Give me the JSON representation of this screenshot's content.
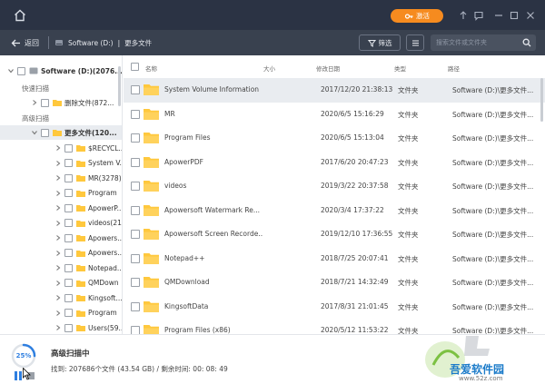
{
  "titlebar": {
    "activate_label": "激活"
  },
  "navbar": {
    "back_label": "返回",
    "breadcrumb": [
      "Software (D:)",
      "更多文件"
    ],
    "filter_label": "筛选",
    "search_placeholder": "搜索文件或文件夹"
  },
  "sidebar": {
    "root_label": "Software (D:)(2076...",
    "quick_scan_section": "快速扫描",
    "deleted_files_label": "删除文件(872...",
    "advanced_scan_section": "高级扫描",
    "more_files_label": "更多文件(120...",
    "tree_items": [
      "$RECYCL...",
      "System V...",
      "MR(3278)",
      "Program",
      "ApowerP...",
      "videos(21",
      "Apowers...",
      "Apowers...",
      "Notepad...",
      "QMDown",
      "Kingsoft...",
      "Program",
      "Users(59..."
    ]
  },
  "list": {
    "columns": {
      "name": "名称",
      "size": "大小",
      "modified": "修改日期",
      "type": "类型",
      "path": "路径"
    },
    "rows": [
      {
        "name": "System Volume Information",
        "size": "",
        "date": "2017/12/20 21:38:13",
        "type": "文件夹",
        "path": "Software (D:)\\更多文件..."
      },
      {
        "name": "MR",
        "size": "",
        "date": "2020/6/5 15:16:29",
        "type": "文件夹",
        "path": "Software (D:)\\更多文件..."
      },
      {
        "name": "Program Files",
        "size": "",
        "date": "2020/6/5 15:13:04",
        "type": "文件夹",
        "path": "Software (D:)\\更多文件..."
      },
      {
        "name": "ApowerPDF",
        "size": "",
        "date": "2017/6/20 20:47:23",
        "type": "文件夹",
        "path": "Software (D:)\\更多文件..."
      },
      {
        "name": "videos",
        "size": "",
        "date": "2019/3/22 20:37:58",
        "type": "文件夹",
        "path": "Software (D:)\\更多文件..."
      },
      {
        "name": "Apowersoft Watermark Re...",
        "size": "",
        "date": "2020/3/4 17:37:22",
        "type": "文件夹",
        "path": "Software (D:)\\更多文件..."
      },
      {
        "name": "Apowersoft Screen Recorde...",
        "size": "",
        "date": "2019/12/10 17:36:55",
        "type": "文件夹",
        "path": "Software (D:)\\更多文件..."
      },
      {
        "name": "Notepad++",
        "size": "",
        "date": "2018/7/25 20:07:41",
        "type": "文件夹",
        "path": "Software (D:)\\更多文件..."
      },
      {
        "name": "QMDownload",
        "size": "",
        "date": "2018/7/21 14:32:49",
        "type": "文件夹",
        "path": "Software (D:)\\更多文件..."
      },
      {
        "name": "KingsoftData",
        "size": "",
        "date": "2017/8/31 21:01:45",
        "type": "文件夹",
        "path": "Software (D:)\\更多文件..."
      },
      {
        "name": "Program Files (x86)",
        "size": "",
        "date": "2020/5/12 11:53:22",
        "type": "文件夹",
        "path": "Software (D:)\\更多文件..."
      }
    ]
  },
  "status": {
    "progress_percent": 25,
    "progress_label": "25%",
    "title": "高级扫描中",
    "info": "找到: 207686个文件 (43.54 GB) / 剩余时间:   00: 08: 49"
  },
  "watermark": {
    "text": "吾爱软件园",
    "url": "www.52z.com"
  },
  "colors": {
    "titlebar_bg": "#2b3344",
    "navbar_bg": "#39414f",
    "accent_orange": "#f68b1f",
    "folder_yellow": "#ffc83d",
    "progress_blue": "#2f7fe0",
    "selected_row": "#e9ecf0"
  }
}
